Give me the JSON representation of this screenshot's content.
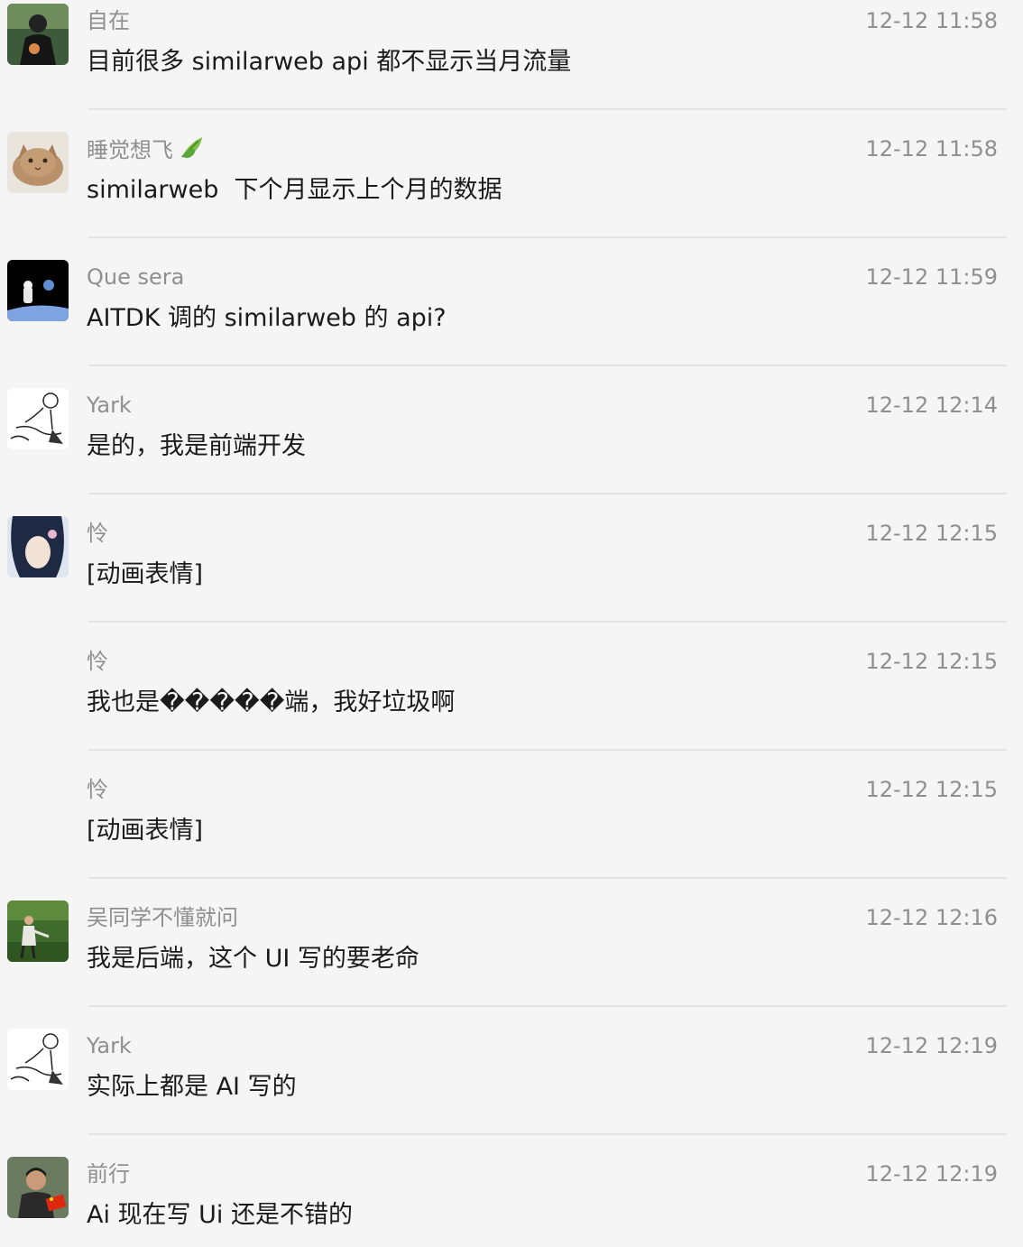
{
  "messages": [
    {
      "sender": "自在",
      "time": "12-12 11:58",
      "text": "目前很多 similarweb api 都不显示当月流量",
      "avatar": "avatar-dark-figure"
    },
    {
      "sender": "睡觉想飞",
      "time": "12-12 11:58",
      "text": "similarweb  下个月显示上个月的数据",
      "avatar": "avatar-cat",
      "badge": "leaf-icon"
    },
    {
      "sender": "Que sera",
      "time": "12-12 11:59",
      "text": "AITDK 调的 similarweb 的 api?",
      "avatar": "avatar-astronaut"
    },
    {
      "sender": "Yark",
      "time": "12-12 12:14",
      "text": "是的，我是前端开发",
      "avatar": "avatar-sketch"
    },
    {
      "sender": "怜",
      "time": "12-12 12:15",
      "text": "[动画表情]",
      "avatar": "avatar-anime-girl"
    },
    {
      "sender": "怜",
      "time": "12-12 12:15",
      "text": "我也是�����端，我好垃圾啊"
    },
    {
      "sender": "怜",
      "time": "12-12 12:15",
      "text": "[动画表情]"
    },
    {
      "sender": "吴同学不懂就问",
      "time": "12-12 12:16",
      "text": "我是后端，这个 UI 写的要老命",
      "avatar": "avatar-person-outdoor"
    },
    {
      "sender": "Yark",
      "time": "12-12 12:19",
      "text": "实际上都是 AI 写的",
      "avatar": "avatar-sketch"
    },
    {
      "sender": "前行",
      "time": "12-12 12:19",
      "text": "Ai 现在写 Ui 还是不错的",
      "avatar": "avatar-man-flag"
    }
  ]
}
